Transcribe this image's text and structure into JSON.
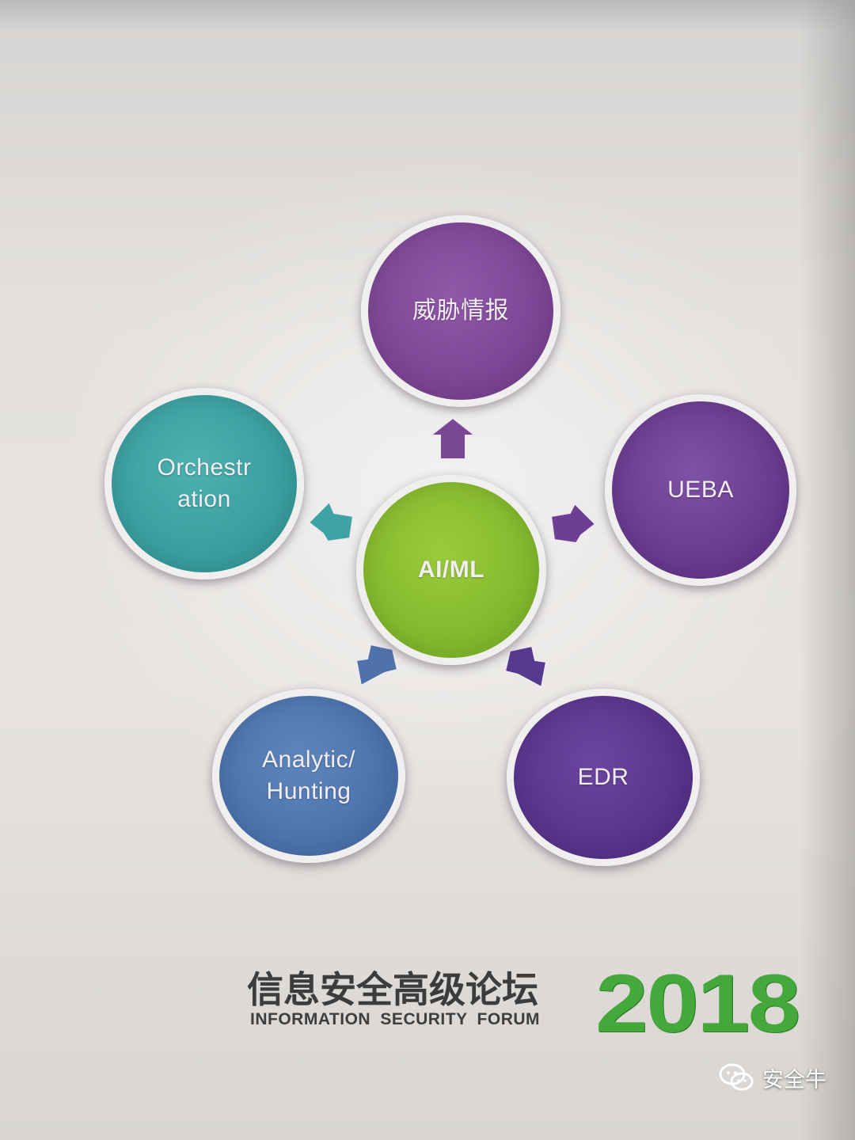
{
  "diagram": {
    "center": {
      "label": "AI/ML",
      "color": "#8bbf33"
    },
    "nodes": [
      {
        "id": "threat-intel",
        "label": "威胁情报",
        "color": "#8650a0"
      },
      {
        "id": "ueba",
        "label": "UEBA",
        "color": "#704298"
      },
      {
        "id": "orchestration",
        "label": "Orchestr\nation",
        "color": "#41a6a7"
      },
      {
        "id": "analytic-hunting",
        "label": "Analytic/\nHunting",
        "color": "#537ab3"
      },
      {
        "id": "edr",
        "label": "EDR",
        "color": "#5f3c94"
      }
    ],
    "arrow_colors": {
      "threat-intel": "#7a4794",
      "orchestration": "#3ea3a5",
      "ueba": "#6c3f95",
      "analytic-hunting": "#4f72ad",
      "edr": "#563a8f"
    }
  },
  "forum": {
    "name_cn": "信息安全高级论坛",
    "name_en": "INFORMATION SECURITY FORUM",
    "year": "2018",
    "year_color": "#45a83a"
  },
  "watermark": {
    "text": "安全牛",
    "icon": "wechat-icon"
  }
}
